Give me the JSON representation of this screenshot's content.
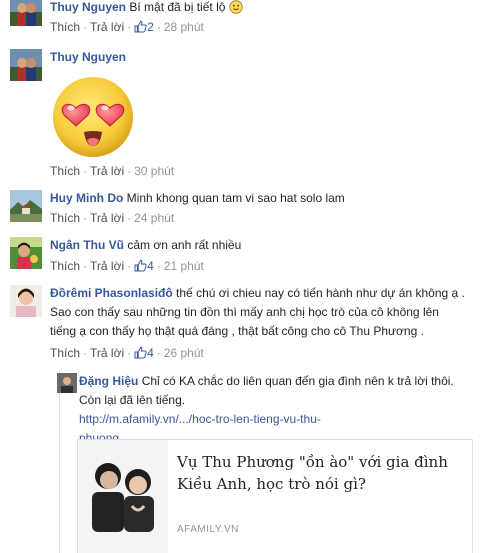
{
  "comments": [
    {
      "author": "Thuy Nguyen",
      "text": "Bí mật đã bị tiết lộ",
      "emoji": "slightly-smiling-face",
      "actions": {
        "like": "Thích",
        "reply": "Trả lời",
        "like_count": "2",
        "time": "28 phút"
      }
    },
    {
      "author": "Thuy Nguyen",
      "sticker": "heart-eyes-face-sticker",
      "actions": {
        "like": "Thích",
        "reply": "Trả lời",
        "time": "30 phút"
      }
    },
    {
      "author": "Huy Minh Do",
      "text": "Minh khong quan tam vi sao hat solo lam",
      "actions": {
        "like": "Thích",
        "reply": "Trả lời",
        "time": "24 phút"
      }
    },
    {
      "author": "Ngân Thu Vũ",
      "text": "cảm ơn anh rất nhiều",
      "actions": {
        "like": "Thích",
        "reply": "Trả lời",
        "like_count": "4",
        "time": "21 phút"
      }
    },
    {
      "author": "Đồrêmi Phasonlasiđô",
      "text_lines": [
        "thế chú ơi chieu nay có tiến hành như dự án không ạ .",
        "Sao con thấy sau những tin đồn thì mấy anh chị học trò của cô không lên",
        "tiếng ạ con thấy họ thật quá đáng , thật bất công cho cô Thu Phương ."
      ],
      "actions": {
        "like": "Thích",
        "reply": "Trả lời",
        "like_count": "4",
        "time": "26 phút"
      }
    }
  ],
  "reply": {
    "author": "Đặng Hiệu",
    "text_lines": [
      "Chỉ có KA chắc do liên quan đến gia đình nên k trả lời thôi.",
      "Còn lại đã lên tiếng."
    ],
    "url_line1": "http://m.afamily.vn/.../hoc-tro-len-tieng-vu-thu-",
    "url_line2": "phuong..."
  },
  "link_card": {
    "title_line1": "Vụ Thu Phương \"ồn ào\" với gia đình",
    "title_line2": "Kiều Anh, học trò nói gì?",
    "source": "AFAMILY.VN"
  },
  "colors": {
    "name": "#365899",
    "meta": "#90949c",
    "action": "#4b4f56",
    "text": "#1d2129",
    "divider": "#dddfe2"
  }
}
